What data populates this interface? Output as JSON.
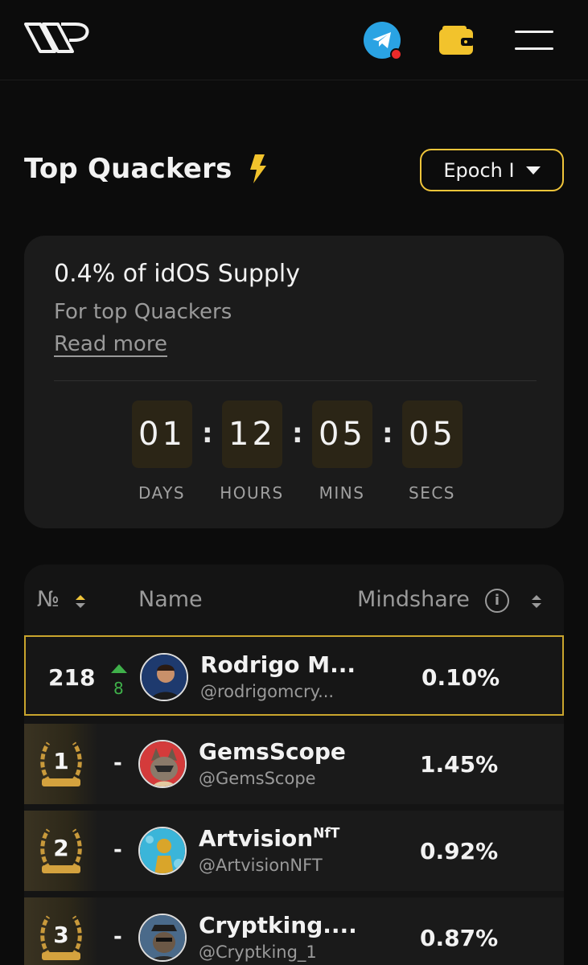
{
  "header": {
    "logo_icon": "brand-logo-icon",
    "telegram_icon": "telegram-icon",
    "wallet_icon": "wallet-icon",
    "menu_icon": "hamburger-menu-icon",
    "notification_color": "#ea2a2a"
  },
  "page": {
    "title": "Top Quackers",
    "title_icon": "lightning-bolt-icon",
    "epoch_selector": "Epoch I"
  },
  "reward_card": {
    "headline": "0.4% of idOS Supply",
    "subtitle": "For top Quackers",
    "read_more": "Read more",
    "countdown": [
      {
        "value": "01",
        "label": "DAYS"
      },
      {
        "value": "12",
        "label": "HOURS"
      },
      {
        "value": "05",
        "label": "MINS"
      },
      {
        "value": "05",
        "label": "SECS"
      }
    ],
    "separator": ":"
  },
  "leaderboard": {
    "columns": {
      "rank": "№",
      "name": "Name",
      "mindshare": "Mindshare"
    },
    "rows": [
      {
        "rank": "218",
        "change": "8",
        "name": "Rodrigo M...",
        "handle": "@rodrigomcry...",
        "mindshare": "0.10%",
        "highlight": true
      },
      {
        "rank": "1",
        "change": "-",
        "name": "GemsScope",
        "handle": "@GemsScope",
        "mindshare": "1.45%"
      },
      {
        "rank": "2",
        "change": "-",
        "name": "Artvision",
        "name_sup": "NfT",
        "handle": "@ArtvisionNFT",
        "mindshare": "0.92%"
      },
      {
        "rank": "3",
        "change": "-",
        "name": "Cryptking....",
        "handle": "@Cryptking_1",
        "mindshare": "0.87%"
      }
    ]
  },
  "colors": {
    "accent": "#f0c53a",
    "background": "#0c0c0c",
    "card": "#1b1b1b",
    "rank_up": "#3fb04a"
  }
}
